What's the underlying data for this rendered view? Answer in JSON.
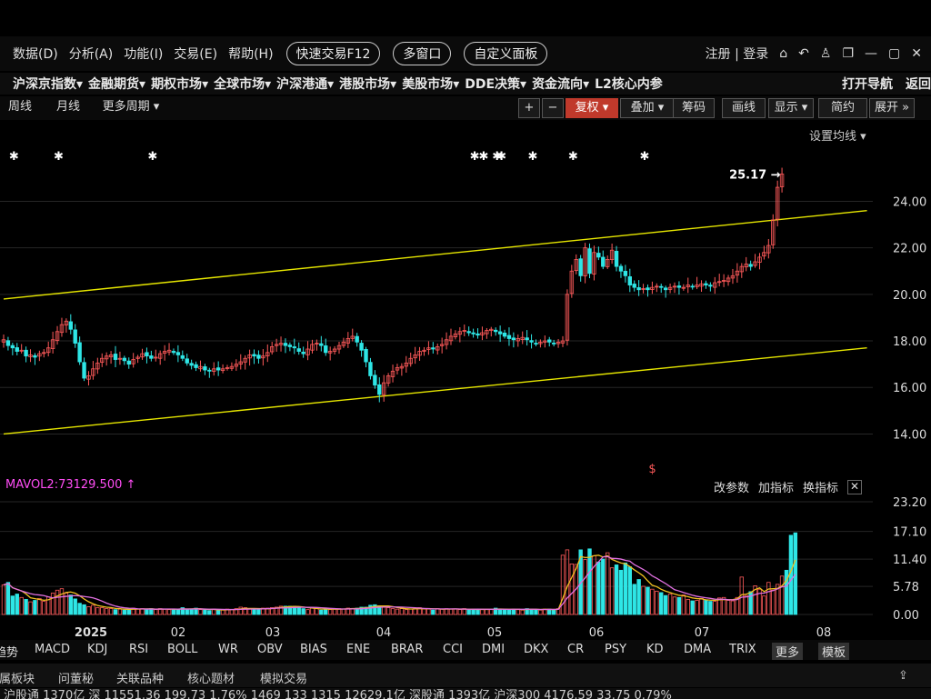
{
  "menu": {
    "items": [
      "数据(D)",
      "分析(A)",
      "功能(I)",
      "交易(E)",
      "帮助(H)"
    ],
    "pills": [
      "快速交易F12",
      "多窗口",
      "自定义面板"
    ],
    "auth": "注册 | 登录"
  },
  "nav": {
    "items": [
      "沪深京指数",
      "金融期货",
      "期权市场",
      "全球市场",
      "沪深港通",
      "港股市场",
      "美股市场",
      "DDE决策",
      "资金流向",
      "L2核心内参"
    ],
    "right": [
      "打开导航",
      "返回"
    ]
  },
  "toolbar": {
    "left": [
      "周线",
      "月线",
      "更多周期"
    ],
    "right": [
      "+",
      "−",
      "复权",
      "叠加",
      "筹码",
      "画线",
      "显示",
      "简约",
      "展开"
    ],
    "set_ma": "设置均线"
  },
  "colors": {
    "up": "#ff5a5a",
    "down": "#2ee6e6",
    "channel": "#e6e600",
    "ma1": "#f0c020",
    "ma2": "#e070e0",
    "background": "#000000"
  },
  "chart_data": [
    {
      "type": "candlestick",
      "title": "",
      "y_ticks": [
        "24.00",
        "22.00",
        "20.00",
        "18.00",
        "16.00",
        "14.00"
      ],
      "ylim": [
        13.9,
        26.4
      ],
      "last_price_label": "25.17",
      "x_ticks": [
        "2025",
        "02",
        "03",
        "04",
        "05",
        "06",
        "07",
        "08"
      ],
      "channel_lines": [
        {
          "name": "upper",
          "from": [
            0,
            19.8
          ],
          "to": [
            193,
            23.6
          ]
        },
        {
          "name": "lower",
          "from": [
            0,
            14.0
          ],
          "to": [
            193,
            17.7
          ]
        }
      ],
      "closes": [
        18.05,
        17.8,
        17.7,
        17.55,
        17.6,
        17.35,
        17.4,
        17.3,
        17.45,
        17.5,
        17.7,
        18.05,
        18.4,
        18.7,
        18.85,
        18.5,
        17.9,
        17.1,
        16.4,
        16.5,
        16.8,
        17.05,
        17.25,
        17.35,
        17.4,
        17.2,
        17.25,
        17.15,
        17.0,
        17.2,
        17.3,
        17.45,
        17.35,
        17.25,
        17.3,
        17.45,
        17.55,
        17.6,
        17.5,
        17.4,
        17.25,
        17.05,
        16.95,
        16.85,
        16.9,
        16.75,
        16.7,
        16.8,
        16.75,
        16.8,
        16.85,
        16.9,
        17.0,
        17.1,
        17.25,
        17.4,
        17.35,
        17.25,
        17.35,
        17.5,
        17.75,
        17.85,
        17.9,
        17.8,
        17.75,
        17.7,
        17.55,
        17.45,
        17.65,
        17.85,
        17.9,
        17.8,
        17.5,
        17.55,
        17.65,
        17.8,
        17.95,
        18.1,
        18.2,
        17.95,
        17.6,
        17.1,
        16.5,
        16.1,
        15.7,
        16.2,
        16.5,
        16.7,
        16.85,
        16.9,
        17.05,
        17.25,
        17.4,
        17.55,
        17.6,
        17.7,
        17.65,
        17.75,
        17.85,
        18.05,
        18.2,
        18.3,
        18.4,
        18.45,
        18.35,
        18.3,
        18.25,
        18.35,
        18.45,
        18.5,
        18.4,
        18.3,
        18.2,
        18.1,
        18.05,
        18.1,
        18.15,
        18.05,
        17.95,
        17.9,
        17.95,
        18.0,
        17.95,
        17.9,
        17.95,
        18.0,
        20.0,
        21.0,
        21.5,
        20.8,
        22.0,
        20.9,
        21.8,
        21.6,
        21.2,
        21.5,
        21.9,
        21.2,
        21.0,
        20.8,
        20.4,
        20.3,
        20.2,
        20.25,
        20.2,
        20.3,
        20.35,
        20.3,
        20.2,
        20.3,
        20.35,
        20.3,
        20.3,
        20.4,
        20.35,
        20.4,
        20.45,
        20.4,
        20.35,
        20.5,
        20.55,
        20.6,
        20.7,
        20.8,
        21.0,
        21.2,
        21.3,
        21.2,
        21.4,
        21.6,
        21.8,
        22.1,
        23.2,
        24.6,
        25.17
      ],
      "volume_panel": {
        "label": "MAVOL2:73129.500",
        "y_ticks": [
          "23.20",
          "17.10",
          "11.40",
          "5.78",
          "0.00"
        ],
        "ylim": [
          0,
          23.2
        ],
        "values": [
          6.1,
          6.6,
          3.8,
          4.2,
          3.5,
          3.1,
          2.6,
          2.9,
          3.3,
          2.7,
          3.6,
          4.4,
          5.0,
          5.3,
          4.4,
          4.0,
          3.2,
          2.3,
          2.0,
          1.6,
          1.9,
          1.4,
          1.4,
          1.2,
          1.2,
          1.0,
          1.1,
          0.9,
          1.1,
          1.3,
          1.1,
          1.2,
          1.0,
          1.2,
          1.0,
          1.2,
          1.1,
          1.0,
          1.1,
          1.1,
          1.4,
          1.0,
          1.1,
          1.3,
          1.0,
          1.0,
          0.8,
          1.1,
          0.9,
          0.9,
          1.1,
          1.0,
          1.2,
          1.5,
          1.4,
          1.1,
          1.0,
          1.1,
          1.3,
          1.3,
          1.4,
          1.5,
          1.7,
          1.7,
          1.7,
          1.7,
          1.4,
          1.2,
          1.0,
          1.3,
          1.2,
          0.9,
          1.1,
          1.0,
          1.2,
          1.2,
          1.1,
          1.3,
          1.2,
          1.3,
          1.5,
          1.5,
          1.9,
          2.0,
          1.8,
          1.6,
          1.4,
          1.2,
          1.1,
          1.2,
          1.0,
          1.1,
          1.3,
          1.4,
          1.1,
          1.1,
          0.9,
          1.2,
          1.1,
          1.2,
          1.1,
          1.1,
          1.0,
          1.2,
          0.9,
          1.1,
          1.0,
          1.1,
          1.1,
          1.0,
          1.3,
          1.1,
          1.0,
          0.9,
          1.1,
          1.1,
          0.9,
          1.2,
          1.1,
          1.0,
          0.9,
          1.1,
          1.1,
          1.0,
          1.2,
          12.2,
          13.3,
          10.4,
          10.3,
          13.3,
          11.3,
          13.5,
          12.1,
          10.8,
          11.4,
          12.7,
          9.6,
          10.2,
          9.1,
          10.6,
          9.8,
          6.2,
          7.2,
          5.8,
          5.6,
          5.2,
          4.8,
          4.5,
          3.9,
          4.2,
          3.6,
          3.5,
          4.0,
          3.1,
          2.8,
          2.9,
          3.3,
          3.0,
          2.7,
          2.7,
          3.4,
          3.5,
          2.9,
          2.8,
          3.5,
          7.7,
          3.9,
          4.7,
          5.9,
          5.2,
          3.8,
          6.6,
          5.0,
          6.2,
          7.9,
          9.1,
          16.3,
          16.8
        ]
      }
    }
  ],
  "indicator_actions": [
    "改参数",
    "加指标",
    "换指标"
  ],
  "indicator_tabs": [
    "趋势",
    "MACD",
    "KDJ",
    "RSI",
    "BOLL",
    "WR",
    "OBV",
    "BIAS",
    "ENE",
    "BRAR",
    "CCI",
    "DMI",
    "DKX",
    "CR",
    "PSY",
    "KD",
    "DMA",
    "TRIX",
    "更多",
    "模板"
  ],
  "bottom_tabs": [
    "所属板块",
    "问董秘",
    "关联品种",
    "核心题材",
    "模拟交易"
  ],
  "status": "沪股通  1370亿  深  11551.36  199.73  1.76%  1469  133  1315  12629.1亿  深股通  1393亿  沪深300  4176.59  33.75  0.79%"
}
